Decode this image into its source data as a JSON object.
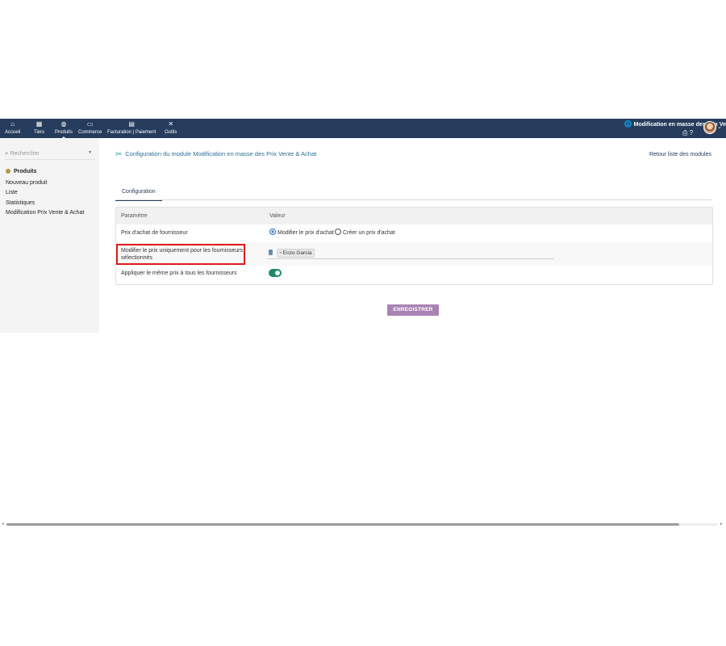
{
  "topbar": {
    "nav": [
      {
        "label": "Accueil",
        "icon": "home-icon",
        "glyph": "⌂"
      },
      {
        "label": "Tiers",
        "icon": "building-icon",
        "glyph": "▦"
      },
      {
        "label": "Produits",
        "icon": "cube-icon",
        "glyph": "◍"
      },
      {
        "label": "Commerce",
        "icon": "briefcase-icon",
        "glyph": "▭"
      },
      {
        "label": "Facturation | Paiement",
        "icon": "invoice-icon",
        "glyph": "▤"
      },
      {
        "label": "Outils",
        "icon": "tools-icon",
        "glyph": "✕"
      }
    ],
    "active_nav": "Produits",
    "module_title": "Modification en masse des Prix Ve",
    "globe_glyph": "🌐",
    "print_glyph": "⎙",
    "help_glyph": "?",
    "caret_glyph": "⌄",
    "background_color": "#263c5c"
  },
  "sidebar": {
    "search_placeholder": "Rechercher",
    "search_glyph": "⌕",
    "dropdown_glyph": "▼",
    "section_title": "Produits",
    "links": [
      "Nouveau produit",
      "Liste",
      "Statistiques",
      "Modification Prix Vente & Achat"
    ]
  },
  "main": {
    "page_title": "Configuration du module Modification en masse des Prix Vente & Achat",
    "wrench_glyph": "✂",
    "back_link": "Retour liste des modules",
    "tab_label": "Configuration",
    "table": {
      "headers": [
        "Paramètre",
        "Valeur"
      ],
      "rows": [
        {
          "param": "Prix d'achat de fournisseur",
          "radio_options": [
            "Modifier le prix d'achat",
            "Créer un prix d'achat"
          ],
          "selected": "Modifier le prix d'achat"
        },
        {
          "param_line1": "Modifier le prix uniquement pour les fournisseurs",
          "param_line2": "sélectionnés",
          "tag_remove": "×",
          "tag": "Enzo Garcia"
        },
        {
          "param": "Appliquer le même prix à tous les fournisseurs",
          "toggle_on": true
        }
      ]
    },
    "save_button": "ENREGISTRER",
    "save_button_color": "#a983b3",
    "highlight_color": "#e01b1b"
  },
  "scrollbar": {
    "left_glyph": "◂",
    "right_glyph": "▸",
    "thumb_fraction": 0.95
  }
}
